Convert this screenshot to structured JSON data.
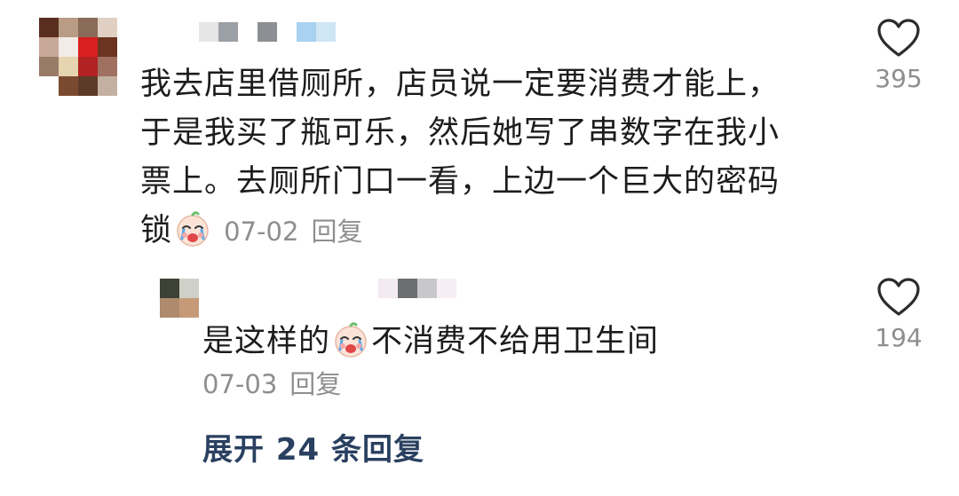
{
  "comment": {
    "text": "我去店里借厕所，店员说一定要消费才能上，于是我买了瓶可乐，然后她写了串数字在我小票上。去厕所门口一看，上边一个巨大的密码锁",
    "emoji": "crying-face-emoji",
    "date": "07-02",
    "reply_label": "回复",
    "like_count": "395",
    "avatar_colors": [
      "#5a2e1e",
      "#b89c86",
      "#8a6a58",
      "#e0d0c4",
      "#c8a898",
      "#f2ece6",
      "#d82020",
      "#6a3420",
      "#9a7a68",
      "#e6d3b0",
      "#b22222",
      "#a07060",
      "#ffffff",
      "#7a4a30",
      "#5c3a28",
      "#c4b0a0"
    ],
    "name_colors": [
      "#e6e6e6",
      "#9aa0a6",
      "#ffffff",
      "#8c8f93",
      "#ffffff",
      "#a8d2f0",
      "#cfe6f5"
    ]
  },
  "reply": {
    "text_before": "是这样的",
    "emoji": "crying-face-emoji",
    "text_after": "不消费不给用卫生间",
    "date": "07-03",
    "reply_label": "回复",
    "like_count": "194",
    "avatar_colors": [
      "#3e4236",
      "#cfd1c8",
      "#b08a6c",
      "#c69a78"
    ],
    "name_colors": [
      "#f4eaf2",
      "#6c6f72",
      "#c8c8cc",
      "#f6eef4"
    ]
  },
  "expand": {
    "label": "展开 24 条回复"
  },
  "icons": {
    "like": "heart-outline-icon"
  }
}
